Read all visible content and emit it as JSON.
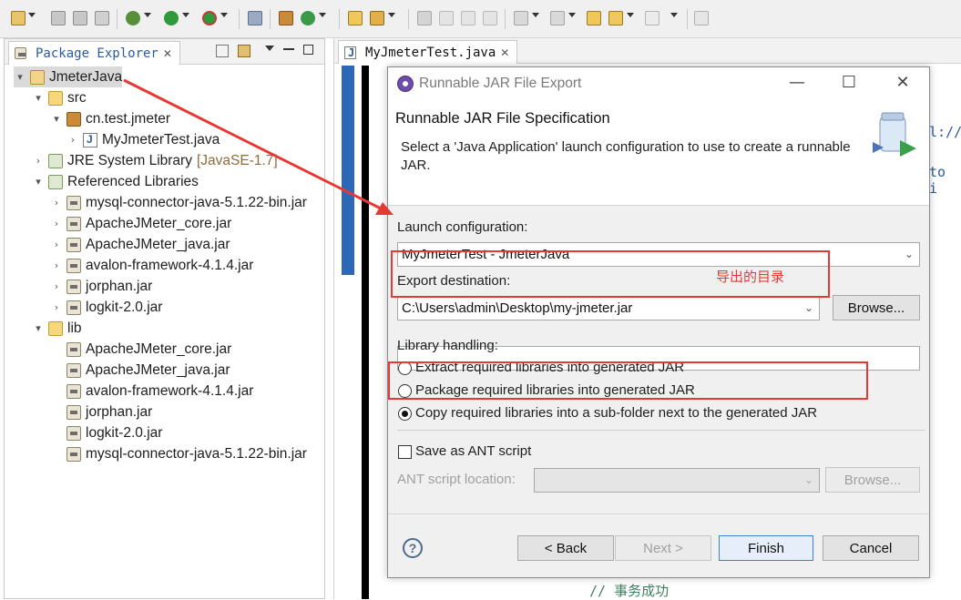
{
  "package_explorer": {
    "tab_label": "Package Explorer",
    "tab_close": "✕",
    "tree": [
      {
        "label": "JmeterJava",
        "twisty": "▾",
        "icon": "project-icon",
        "selected": true
      },
      {
        "label": "src",
        "twisty": "▾",
        "icon": "source-folder-icon"
      },
      {
        "label": "cn.test.jmeter",
        "twisty": "▾",
        "icon": "package-icon"
      },
      {
        "label": "MyJmeterTest.java",
        "twisty": "›",
        "icon": "java-file-icon"
      },
      {
        "label": "JRE System Library",
        "suffix": "[JavaSE-1.7]",
        "twisty": "›",
        "icon": "library-icon"
      },
      {
        "label": "Referenced Libraries",
        "twisty": "▾",
        "icon": "library-icon"
      },
      {
        "label": "mysql-connector-java-5.1.22-bin.jar",
        "twisty": "›",
        "icon": "jar-icon"
      },
      {
        "label": "ApacheJMeter_core.jar",
        "twisty": "›",
        "icon": "jar-icon"
      },
      {
        "label": "ApacheJMeter_java.jar",
        "twisty": "›",
        "icon": "jar-icon"
      },
      {
        "label": "avalon-framework-4.1.4.jar",
        "twisty": "›",
        "icon": "jar-icon"
      },
      {
        "label": "jorphan.jar",
        "twisty": "›",
        "icon": "jar-icon"
      },
      {
        "label": "logkit-2.0.jar",
        "twisty": "›",
        "icon": "jar-icon"
      },
      {
        "label": "lib",
        "twisty": "▾",
        "icon": "folder-icon"
      },
      {
        "label": "ApacheJMeter_core.jar",
        "icon": "jar-file-icon"
      },
      {
        "label": "ApacheJMeter_java.jar",
        "icon": "jar-file-icon"
      },
      {
        "label": "avalon-framework-4.1.4.jar",
        "icon": "jar-file-icon"
      },
      {
        "label": "jorphan.jar",
        "icon": "jar-file-icon"
      },
      {
        "label": "logkit-2.0.jar",
        "icon": "jar-file-icon"
      },
      {
        "label": "mysql-connector-java-5.1.22-bin.jar",
        "icon": "jar-file-icon"
      }
    ]
  },
  "editor": {
    "tab_label": "MyJmeterTest.java",
    "tab_close": "✕",
    "code_fragment_1": "l://",
    "code_fragment_2": "to i",
    "comment_line": "//  事务成功"
  },
  "dialog": {
    "window_title": "Runnable JAR File Export",
    "minimize": "—",
    "maximize": "☐",
    "close": "✕",
    "heading": "Runnable JAR File Specification",
    "description": "Select a 'Java Application' launch configuration to use to create a runnable JAR.",
    "launch_config_label": "Launch configuration:",
    "launch_config_value": "MyJmeterTest - JmeterJava",
    "export_dest_label": "Export destination:",
    "export_dest_value": "C:\\Users\\admin\\Desktop\\my-jmeter.jar",
    "export_note": "导出的目录",
    "browse_label": "Browse...",
    "library_handling_label": "Library handling:",
    "library_options": [
      {
        "label": "Extract required libraries into generated JAR",
        "selected": false
      },
      {
        "label": "Package required libraries into generated JAR",
        "selected": false
      },
      {
        "label": "Copy required libraries into a sub-folder next to the generated JAR",
        "selected": true
      }
    ],
    "save_ant_label": "Save as ANT script",
    "save_ant_checked": false,
    "ant_location_label": "ANT script location:",
    "ant_browse_label": "Browse...",
    "back_label": "< Back",
    "next_label": "Next >",
    "finish_label": "Finish",
    "cancel_label": "Cancel",
    "help_symbol": "?"
  },
  "colors": {
    "highlight_red": "#e53935",
    "selection_grey": "#dadada",
    "link_blue": "#2c5aa0"
  }
}
